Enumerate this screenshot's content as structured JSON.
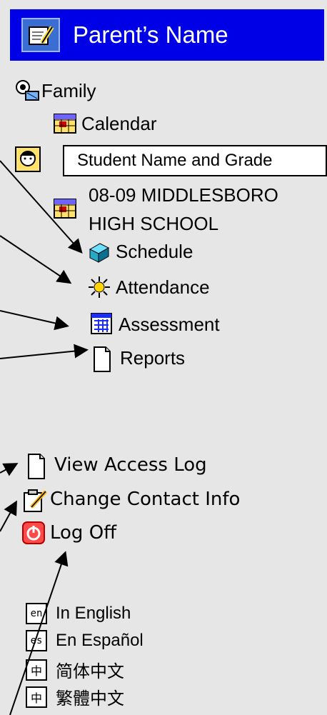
{
  "header": {
    "title": "Parent’s Name",
    "logo_icon": "gradebook-icon"
  },
  "family": {
    "label": "Family",
    "icon": "family-icon"
  },
  "calendar": {
    "label": "Calendar",
    "icon": "calendar-icon"
  },
  "student": {
    "callout": "Student Name and Grade",
    "icon": "student-icon"
  },
  "school": {
    "line1": "08-09 MIDDLESBORO",
    "line2": "HIGH SCHOOL",
    "icon": "calendar-icon"
  },
  "nav": {
    "schedule": "Schedule",
    "attendance": "Attendance",
    "assessment": "Assessment",
    "reports": "Reports"
  },
  "account": {
    "view_access_log": "View Access Log",
    "change_contact_info": "Change Contact Info",
    "log_off": "Log Off"
  },
  "languages": {
    "english": {
      "badge": "en",
      "label": "In English"
    },
    "spanish": {
      "badge": "es",
      "label": "En Español"
    },
    "simplified": {
      "badge": "中",
      "label": "简体中文"
    },
    "traditional": {
      "badge": "中",
      "label": "繁體中文"
    }
  }
}
